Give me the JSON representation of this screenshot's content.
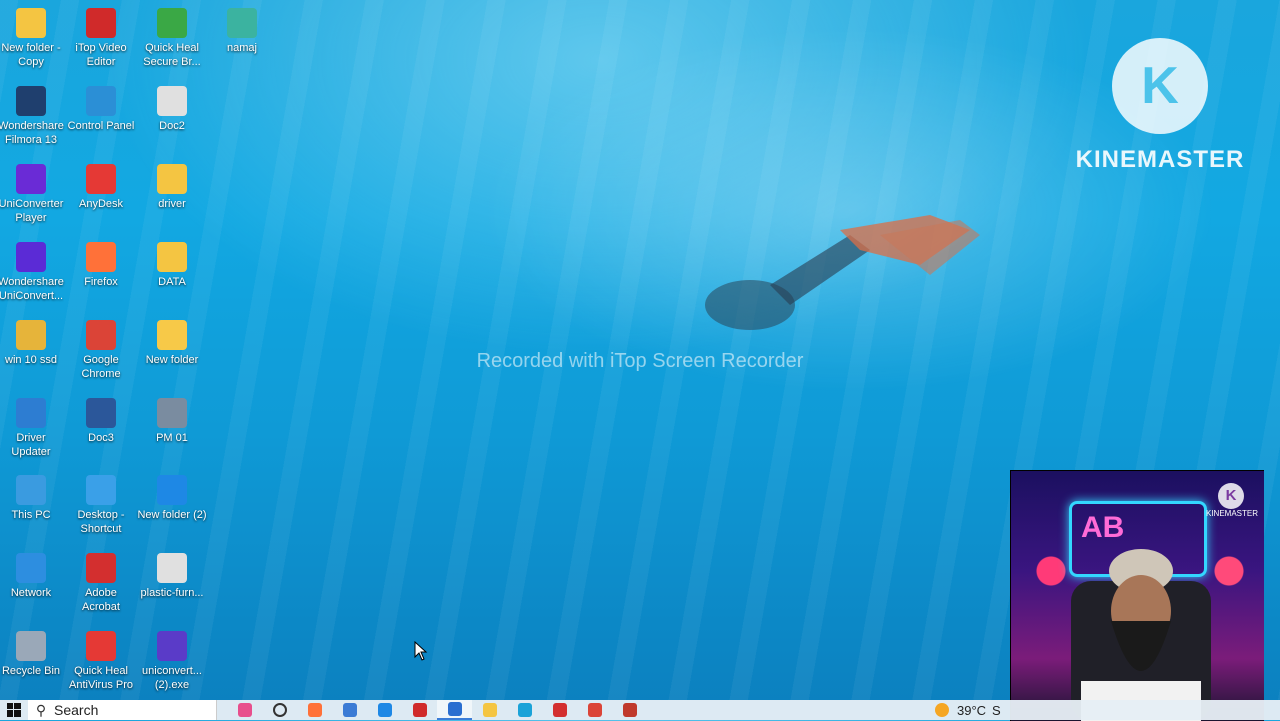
{
  "desktop": {
    "icons": [
      {
        "label": "New folder - Copy",
        "icon": "folder-icon",
        "color": "#f4c542"
      },
      {
        "label": "iTop Video Editor",
        "icon": "itop-video-editor-icon",
        "color": "#d02a2a"
      },
      {
        "label": "Quick Heal Secure Br...",
        "icon": "quick-heal-browser-icon",
        "color": "#3aa845"
      },
      {
        "label": "namaj",
        "icon": "file-icon",
        "color": "#3bb3a0"
      },
      {
        "label": "Wondershare Filmora 13",
        "icon": "filmora-icon",
        "color": "#1f3f6e"
      },
      {
        "label": "Control Panel",
        "icon": "control-panel-icon",
        "color": "#2b8fd6"
      },
      {
        "label": "Doc2",
        "icon": "pdf-icon",
        "color": "#e0e0e0"
      },
      {
        "label": "UniConverter Player",
        "icon": "uniconverter-player-icon",
        "color": "#6a2bd6"
      },
      {
        "label": "AnyDesk",
        "icon": "anydesk-icon",
        "color": "#e53935"
      },
      {
        "label": "driver",
        "icon": "folder-icon",
        "color": "#f4c542"
      },
      {
        "label": "Wondershare UniConvert...",
        "icon": "uniconverter-icon",
        "color": "#5b2bd6"
      },
      {
        "label": "Firefox",
        "icon": "firefox-icon",
        "color": "#ff7139"
      },
      {
        "label": "DATA",
        "icon": "folder-icon",
        "color": "#f4c542"
      },
      {
        "label": "win 10 ssd",
        "icon": "folder-icon",
        "color": "#e6b43a"
      },
      {
        "label": "Google Chrome",
        "icon": "chrome-icon",
        "color": "#db4437"
      },
      {
        "label": "New folder",
        "icon": "emoji-folder-icon",
        "color": "#f7c948"
      },
      {
        "label": "Driver Updater",
        "icon": "driver-updater-icon",
        "color": "#2d7dd2"
      },
      {
        "label": "Doc3",
        "icon": "word-document-icon",
        "color": "#2b579a"
      },
      {
        "label": "PM 01",
        "icon": "image-icon",
        "color": "#7a8ca0"
      },
      {
        "label": "This PC",
        "icon": "computer-icon",
        "color": "#3a9be0"
      },
      {
        "label": "Desktop - Shortcut",
        "icon": "desktop-shortcut-icon",
        "color": "#3aa0e8"
      },
      {
        "label": "New folder (2)",
        "icon": "settings-gear-icon",
        "color": "#1e88e5"
      },
      {
        "label": "Network",
        "icon": "network-icon",
        "color": "#2d8ee0"
      },
      {
        "label": "Adobe Acrobat",
        "icon": "acrobat-icon",
        "color": "#d32f2f"
      },
      {
        "label": "plastic-furn...",
        "icon": "pdf-icon",
        "color": "#e0e0e0"
      },
      {
        "label": "Recycle Bin",
        "icon": "recycle-bin-icon",
        "color": "#9aa8b8"
      },
      {
        "label": "Quick Heal AntiVirus Pro",
        "icon": "quick-heal-icon",
        "color": "#e53935"
      },
      {
        "label": "uniconvert... (2).exe",
        "icon": "exe-installer-icon",
        "color": "#5a3bc8"
      }
    ],
    "watermark": "Recorded with iTop Screen Recorder"
  },
  "kinemaster": {
    "logo_letter": "K",
    "logo_text": "KINEMASTER",
    "small_logo_text": "KINEMASTER"
  },
  "webcam": {
    "neon_text": "AB"
  },
  "taskbar": {
    "search_placeholder": "Search",
    "apps": [
      {
        "name": "mixed-app-icon",
        "color": "#e84f8c"
      },
      {
        "name": "cortana-icon",
        "color": "#333333"
      },
      {
        "name": "firefox-icon",
        "color": "#ff7139"
      },
      {
        "name": "store-icon",
        "color": "#3a7bd5"
      },
      {
        "name": "mail-icon",
        "color": "#1e88e5"
      },
      {
        "name": "itop-video-icon",
        "color": "#d02a2a"
      },
      {
        "name": "itop-recorder-icon",
        "color": "#2a6ed0"
      },
      {
        "name": "file-explorer-icon",
        "color": "#f4c542"
      },
      {
        "name": "edge-icon",
        "color": "#1aa3d8"
      },
      {
        "name": "acrobat-icon",
        "color": "#d32f2f"
      },
      {
        "name": "chrome-icon",
        "color": "#db4437"
      },
      {
        "name": "chrome-profile-icon",
        "color": "#c0392b"
      }
    ],
    "temperature": "39°C",
    "weather_extra": "S"
  }
}
